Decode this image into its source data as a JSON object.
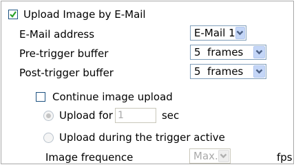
{
  "upload_email": {
    "label": "Upload Image by E-Mail",
    "checked": true
  },
  "email_address": {
    "label": "E-Mail address",
    "selected": "E-Mail 1"
  },
  "pre_trigger": {
    "label": "Pre-trigger buffer",
    "selected": "5  frames"
  },
  "post_trigger": {
    "label": "Post-trigger buffer",
    "selected": "5  frames"
  },
  "continue_upload": {
    "label": "Continue image upload",
    "checked": false
  },
  "upload_for": {
    "label": "Upload for",
    "value": "1",
    "unit": "sec"
  },
  "upload_during": {
    "label": "Upload during the trigger active"
  },
  "image_frequence": {
    "label": "Image frequence",
    "selected": "Max.",
    "unit": "fps"
  },
  "colors": {
    "check_green": "#2aa12a",
    "checkbox_border": "#1c5180",
    "arrow_blue": "#4d6185"
  },
  "icons": {
    "check": "checkmark-icon",
    "dropdown": "chevron-down-icon"
  }
}
